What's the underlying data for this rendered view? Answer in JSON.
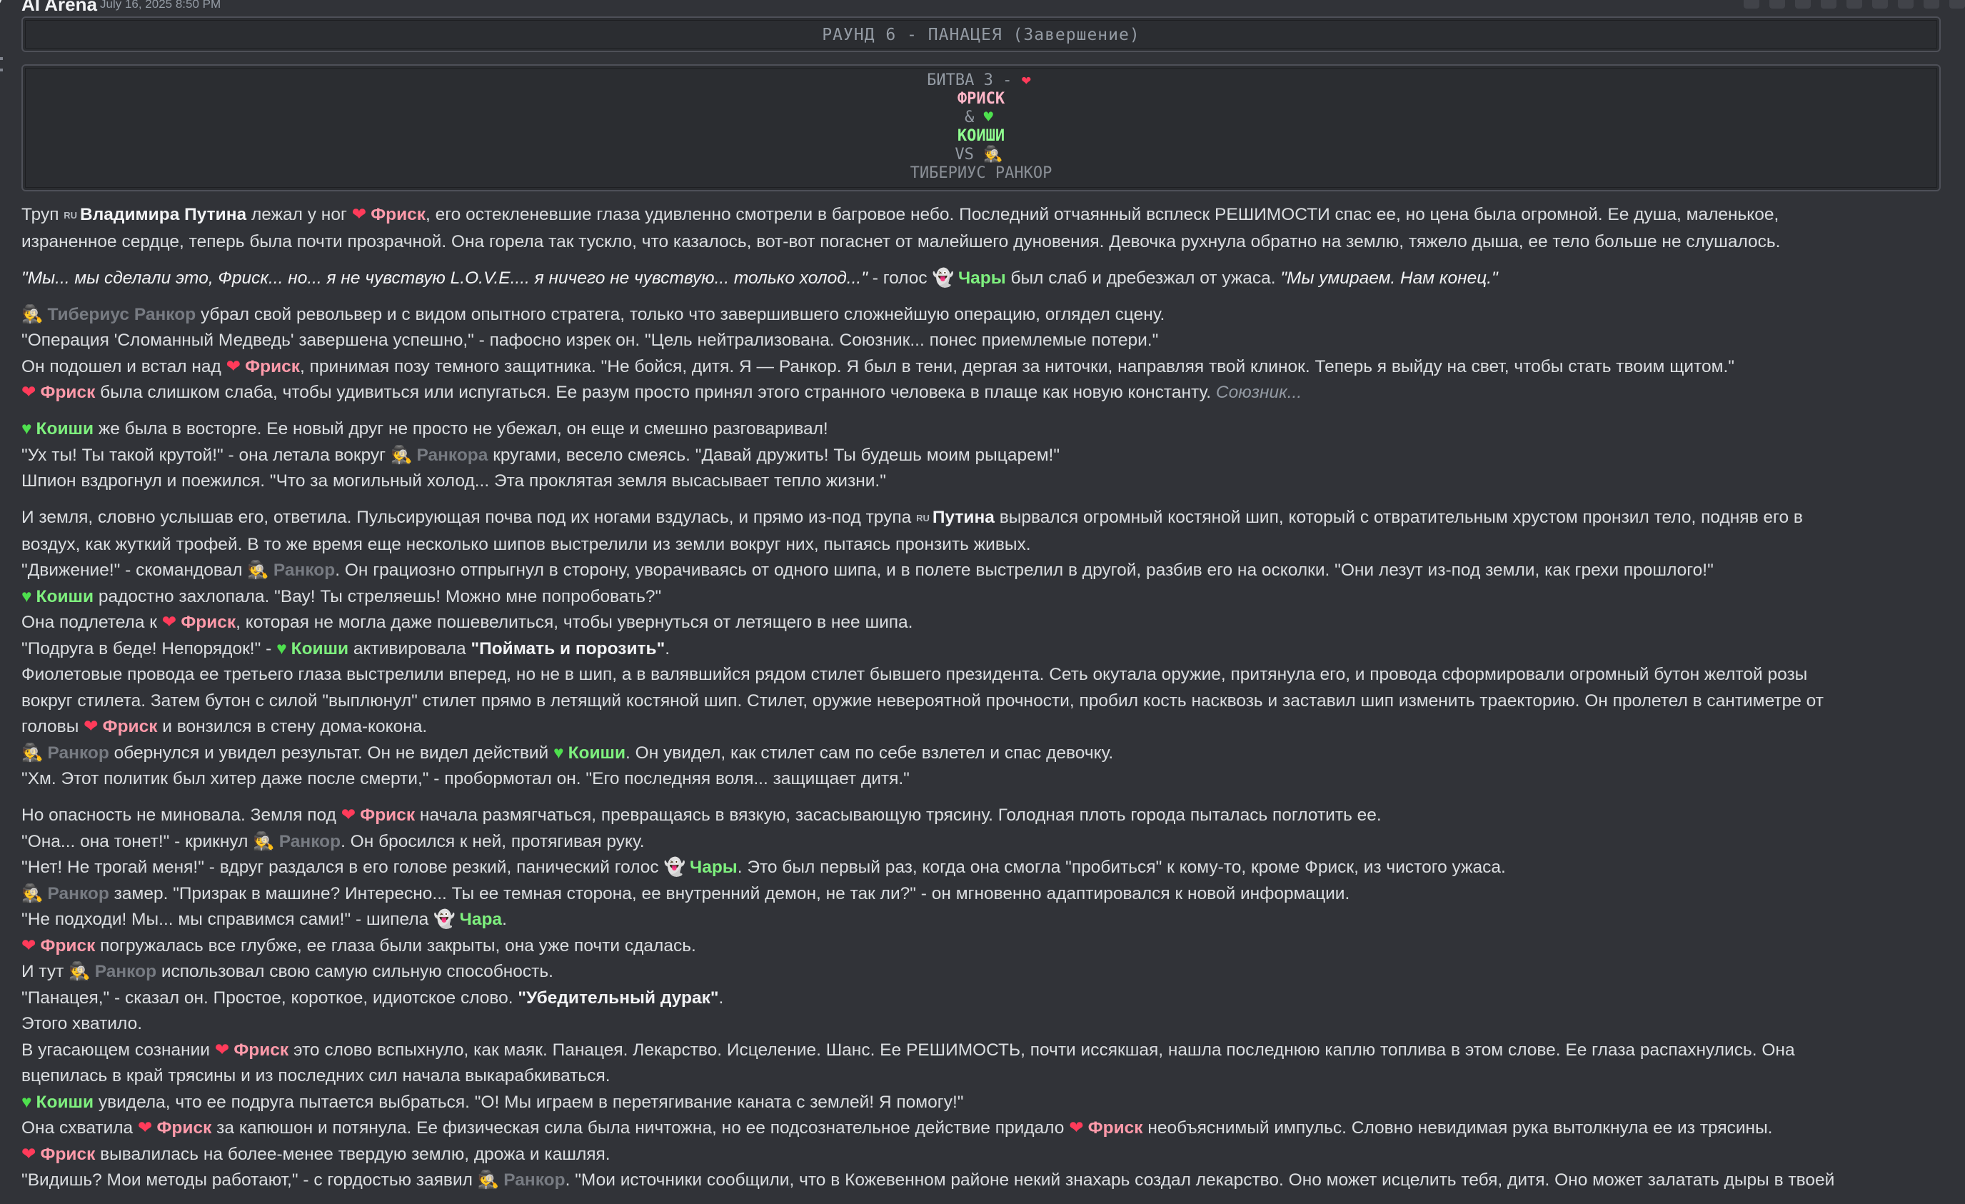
{
  "header": {
    "author": "AI Arena",
    "timestamp": "July 16, 2025 8:50 PM"
  },
  "round_box": {
    "text": "РАУНД 6 - ПАНАЦЕЯ (Завершение)"
  },
  "battle_box": {
    "line1": "БИТВА 3 -",
    "frisk": "ФРИСК",
    "amp": "&",
    "koishi": "КОИШИ",
    "vs": "VS",
    "rancor": "ТИБЕРИУС РАНКОР"
  },
  "icons": {
    "heart": "❤",
    "green_heart": "♥",
    "ghost": "👻",
    "spy": "🕵",
    "flag": "RU"
  },
  "paragraphs": [
    [
      [
        {
          "t": "Труп "
        },
        {
          "t": "flag"
        },
        {
          "t": "Владимира Путина",
          "c": "putin"
        },
        {
          "t": " лежал у ног "
        },
        {
          "t": "heart"
        },
        {
          "t": "Фриск",
          "c": "frisk"
        },
        {
          "t": ", его остекленевшие глаза удивленно смотрели в багровое небо. Последний отчаянный всплеск РЕШИМОСТИ спас ее, но цена была огромной. Ее душа, маленькое,"
        }
      ],
      [
        {
          "t": "израненное сердце, теперь была почти прозрачной. Она горела так тускло, что казалось, вот-вот погаснет от малейшего дуновения. Девочка рухнула обратно на землю, тяжело дыша, ее тело больше не слушалось."
        }
      ]
    ],
    [
      [
        {
          "t": "\"Мы... мы сделали это, Фриск... но... я не чувствую L.O.V.E.... я ничего не чувствую... только холод...\"",
          "c": "ital"
        },
        {
          "t": " - голос "
        },
        {
          "t": "ghost"
        },
        {
          "t": "Чары",
          "c": "chara"
        },
        {
          "t": " был слаб и дребезжал от ужаса. "
        },
        {
          "t": "\"Мы умираем. Нам конец.\"",
          "c": "ital"
        }
      ]
    ],
    [
      [
        {
          "t": "spy"
        },
        {
          "t": "Тибериус Ранкор",
          "c": "rancor"
        },
        {
          "t": " убрал свой револьвер и с видом опытного стратега, только что завершившего сложнейшую операцию, оглядел сцену."
        }
      ],
      [
        {
          "t": "\"Операция 'Сломанный Медведь' завершена успешно,\" - пафосно изрек он. \"Цель нейтрализована. Союзник... понес приемлемые потери.\""
        }
      ],
      [
        {
          "t": "Он подошел и встал над "
        },
        {
          "t": "heart"
        },
        {
          "t": "Фриск",
          "c": "frisk"
        },
        {
          "t": ", принимая позу темного защитника. \"Не бойся, дитя. Я — Ранкор. Я был в тени, дергая за ниточки, направляя твой клинок. Теперь я выйду на свет, чтобы стать твоим щитом.\""
        }
      ],
      [
        {
          "t": "heart"
        },
        {
          "t": "Фриск",
          "c": "frisk"
        },
        {
          "t": " была слишком слаба, чтобы удивиться или испугаться. Ее разум просто принял этого странного человека в плаще как новую константу. "
        },
        {
          "t": "Союзник...",
          "c": "it-dim"
        }
      ]
    ],
    [
      [
        {
          "t": "gheart"
        },
        {
          "t": "Коиши",
          "c": "koishi"
        },
        {
          "t": " же была в восторге. Ее новый друг не просто не убежал, он еще и смешно разговаривал!"
        }
      ],
      [
        {
          "t": "\"Ух ты! Ты такой крутой!\" - она летала вокруг "
        },
        {
          "t": "spy"
        },
        {
          "t": "Ранкора",
          "c": "rancor"
        },
        {
          "t": " кругами, весело смеясь. \"Давай дружить! Ты будешь моим рыцарем!\""
        }
      ],
      [
        {
          "t": "Шпион вздрогнул и поежился. \"Что за могильный холод... Эта проклятая земля высасывает тепло жизни.\""
        }
      ]
    ],
    [
      [
        {
          "t": "И земля, словно услышав его, ответила. Пульсирующая почва под их ногами вздулась, и прямо из-под трупа "
        },
        {
          "t": "flag"
        },
        {
          "t": "Путина",
          "c": "putin"
        },
        {
          "t": " вырвался огромный костяной шип, который с отвратительным хрустом пронзил тело, подняв его в"
        }
      ],
      [
        {
          "t": "воздух, как жуткий трофей. В то же время еще несколько шипов выстрелили из земли вокруг них, пытаясь пронзить живых."
        }
      ],
      [
        {
          "t": "\"Движение!\" - скомандовал "
        },
        {
          "t": "spy"
        },
        {
          "t": "Ранкор",
          "c": "rancor"
        },
        {
          "t": ". Он грациозно отпрыгнул в сторону, уворачиваясь от одного шипа, и в полете выстрелил в другой, разбив его на осколки. \"Они лезут из-под земли, как грехи прошлого!\""
        }
      ],
      [
        {
          "t": "gheart"
        },
        {
          "t": "Коиши",
          "c": "koishi"
        },
        {
          "t": " радостно захлопала. \"Вау! Ты стреляешь! Можно мне попробовать?\""
        }
      ],
      [
        {
          "t": "Она подлетела к "
        },
        {
          "t": "heart"
        },
        {
          "t": "Фриск",
          "c": "frisk"
        },
        {
          "t": ", которая не могла даже пошевелиться, чтобы увернуться от летящего в нее шипа."
        }
      ],
      [
        {
          "t": "\"Подруга в беде! Непорядок!\" - "
        },
        {
          "t": "gheart"
        },
        {
          "t": "Коиши",
          "c": "koishi"
        },
        {
          "t": " активировала "
        },
        {
          "t": "\"Поймать и порозить\"",
          "c": "bold"
        },
        {
          "t": "."
        }
      ],
      [
        {
          "t": "Фиолетовые провода ее третьего глаза выстрелили вперед, но не в шип, а в валявшийся рядом стилет бывшего президента. Сеть окутала оружие, притянула его, и провода сформировали огромный бутон желтой розы"
        }
      ],
      [
        {
          "t": "вокруг стилета. Затем бутон с силой \"выплюнул\" стилет прямо в летящий костяной шип. Стилет, оружие невероятной прочности, пробил кость насквозь и заставил шип изменить траекторию. Он пролетел в сантиметре от"
        }
      ],
      [
        {
          "t": "головы "
        },
        {
          "t": "heart"
        },
        {
          "t": "Фриск",
          "c": "frisk"
        },
        {
          "t": " и вонзился в стену дома-кокона."
        }
      ],
      [
        {
          "t": "spy"
        },
        {
          "t": "Ранкор",
          "c": "rancor"
        },
        {
          "t": " обернулся и увидел результат. Он не видел действий "
        },
        {
          "t": "gheart"
        },
        {
          "t": "Коиши",
          "c": "koishi"
        },
        {
          "t": ". Он увидел, как стилет сам по себе взлетел и спас девочку."
        }
      ],
      [
        {
          "t": "\"Хм. Этот политик был хитер даже после смерти,\" - пробормотал он. \"Его последняя воля... защищает дитя.\""
        }
      ]
    ],
    [
      [
        {
          "t": "Но опасность не миновала. Земля под "
        },
        {
          "t": "heart"
        },
        {
          "t": "Фриск",
          "c": "frisk"
        },
        {
          "t": " начала размягчаться, превращаясь в вязкую, засасывающую трясину. Голодная плоть города пыталась поглотить ее."
        }
      ],
      [
        {
          "t": "\"Она... она тонет!\" - крикнул "
        },
        {
          "t": "spy"
        },
        {
          "t": "Ранкор",
          "c": "rancor"
        },
        {
          "t": ". Он бросился к ней, протягивая руку."
        }
      ],
      [
        {
          "t": "\"Нет! Не трогай меня!\" - вдруг раздался в его голове резкий, панический голос "
        },
        {
          "t": "ghost"
        },
        {
          "t": "Чары",
          "c": "chara"
        },
        {
          "t": ". Это был первый раз, когда она смогла \"пробиться\" к кому-то, кроме Фриск, из чистого ужаса."
        }
      ],
      [
        {
          "t": "spy"
        },
        {
          "t": "Ранкор",
          "c": "rancor"
        },
        {
          "t": " замер. \"Призрак в машине? Интересно... Ты ее темная сторона, ее внутренний демон, не так ли?\" - он мгновенно адаптировался к новой информации."
        }
      ],
      [
        {
          "t": "\"Не подходи! Мы... мы справимся сами!\" - шипела "
        },
        {
          "t": "ghost"
        },
        {
          "t": "Чара",
          "c": "chara"
        },
        {
          "t": "."
        }
      ],
      [
        {
          "t": "heart"
        },
        {
          "t": "Фриск",
          "c": "frisk"
        },
        {
          "t": " погружалась все глубже, ее глаза были закрыты, она уже почти сдалась."
        }
      ],
      [
        {
          "t": "И тут "
        },
        {
          "t": "spy"
        },
        {
          "t": "Ранкор",
          "c": "rancor"
        },
        {
          "t": " использовал свою самую сильную способность."
        }
      ],
      [
        {
          "t": "\"Панацея,\" - сказал он. Простое, короткое, идиотское слово. "
        },
        {
          "t": "\"Убедительный дурак\"",
          "c": "bold"
        },
        {
          "t": "."
        }
      ],
      [
        {
          "t": "Этого хватило."
        }
      ],
      [
        {
          "t": "В угасающем сознании "
        },
        {
          "t": "heart"
        },
        {
          "t": "Фриск",
          "c": "frisk"
        },
        {
          "t": " это слово вспыхнуло, как маяк. Панацея. Лекарство. Исцеление. Шанс. Ее РЕШИМОСТЬ, почти иссякшая, нашла последнюю каплю топлива в этом слове. Ее глаза распахнулись. Она"
        }
      ],
      [
        {
          "t": "вцепилась в край трясины и из последних сил начала выкарабкиваться."
        }
      ],
      [
        {
          "t": "gheart"
        },
        {
          "t": "Коиши",
          "c": "koishi"
        },
        {
          "t": " увидела, что ее подруга пытается выбраться. \"О! Мы играем в перетягивание каната с землей! Я помогу!\""
        }
      ],
      [
        {
          "t": "Она схватила "
        },
        {
          "t": "heart"
        },
        {
          "t": "Фриск",
          "c": "frisk"
        },
        {
          "t": " за капюшон и потянула. Ее физическая сила была ничтожна, но ее подсознательное действие придало "
        },
        {
          "t": "heart"
        },
        {
          "t": "Фриск",
          "c": "frisk"
        },
        {
          "t": " необъяснимый импульс. Словно невидимая рука вытолкнула ее из трясины."
        }
      ],
      [
        {
          "t": "heart"
        },
        {
          "t": "Фриск",
          "c": "frisk"
        },
        {
          "t": " вывалилась на более-менее твердую землю, дрожа и кашляя."
        }
      ],
      [
        {
          "t": "\"Видишь? Мои методы работают,\" - с гордостью заявил "
        },
        {
          "t": "spy"
        },
        {
          "t": "Ранкор",
          "c": "rancor"
        },
        {
          "t": ". \"Мои источники сообщили, что в Кожевенном районе некий знахарь создал лекарство. Оно может исцелить тебя, дитя. Оно может залатать дыры в твоей"
        }
      ]
    ]
  ]
}
